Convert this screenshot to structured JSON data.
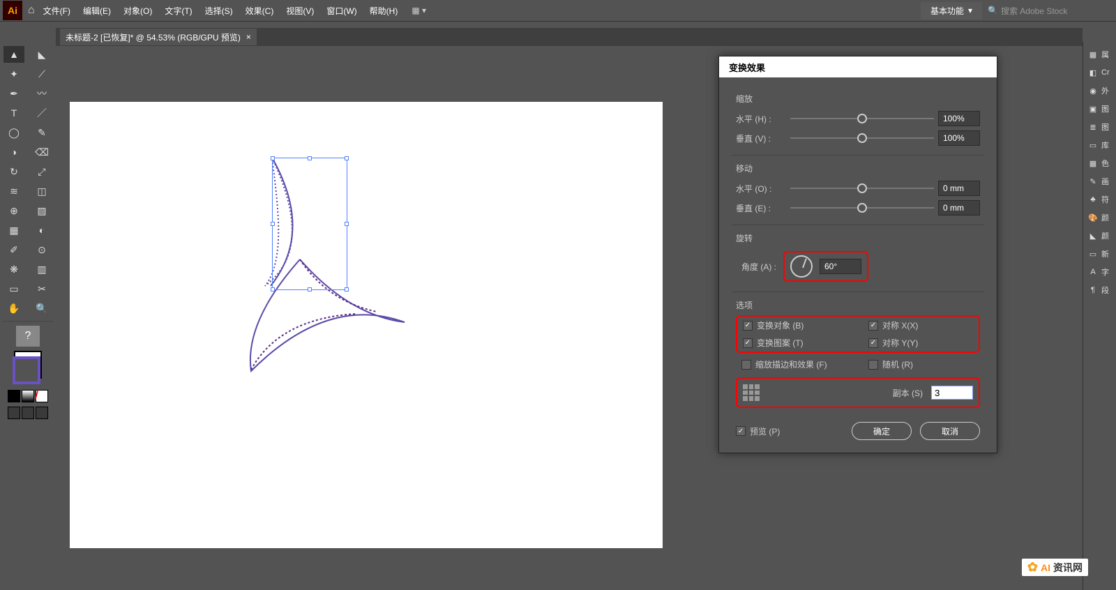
{
  "app": {
    "logo": "Ai"
  },
  "menu": {
    "file": "文件(F)",
    "edit": "编辑(E)",
    "object": "对象(O)",
    "text": "文字(T)",
    "select": "选择(S)",
    "effect": "效果(C)",
    "view": "视图(V)",
    "window": "窗口(W)",
    "help": "帮助(H)"
  },
  "workspace": {
    "label": "基本功能"
  },
  "search": {
    "placeholder": "搜索 Adobe Stock"
  },
  "tab": {
    "title": "未标题-2 [已恢复]* @ 54.53% (RGB/GPU 预览)"
  },
  "dialog": {
    "title": "变换效果",
    "scale": {
      "label": "缩放",
      "h_label": "水平 (H) :",
      "h_value": "100%",
      "v_label": "垂直 (V) :",
      "v_value": "100%"
    },
    "move": {
      "label": "移动",
      "h_label": "水平 (O) :",
      "h_value": "0 mm",
      "v_label": "垂直 (E) :",
      "v_value": "0 mm"
    },
    "rotate": {
      "label": "旋转",
      "angle_label": "角度 (A) :",
      "angle_value": "60°"
    },
    "options": {
      "label": "选项",
      "transform_obj": "变换对象 (B)",
      "reflect_x": "对称 X(X)",
      "transform_pat": "变换图案 (T)",
      "reflect_y": "对称 Y(Y)",
      "scale_stroke": "缩放描边和效果 (F)",
      "random": "随机 (R)"
    },
    "copies": {
      "label": "副本 (S)",
      "value": "3"
    },
    "preview": "预览 (P)",
    "ok": "确定",
    "cancel": "取消"
  },
  "rpanel": {
    "items": [
      "属",
      "Cr",
      "外",
      "图",
      "图",
      "库",
      "色",
      "画",
      "符",
      "颜",
      "颜",
      "新",
      "字",
      "段"
    ]
  },
  "watermark": {
    "a": "AI",
    "rest": "资讯网"
  }
}
